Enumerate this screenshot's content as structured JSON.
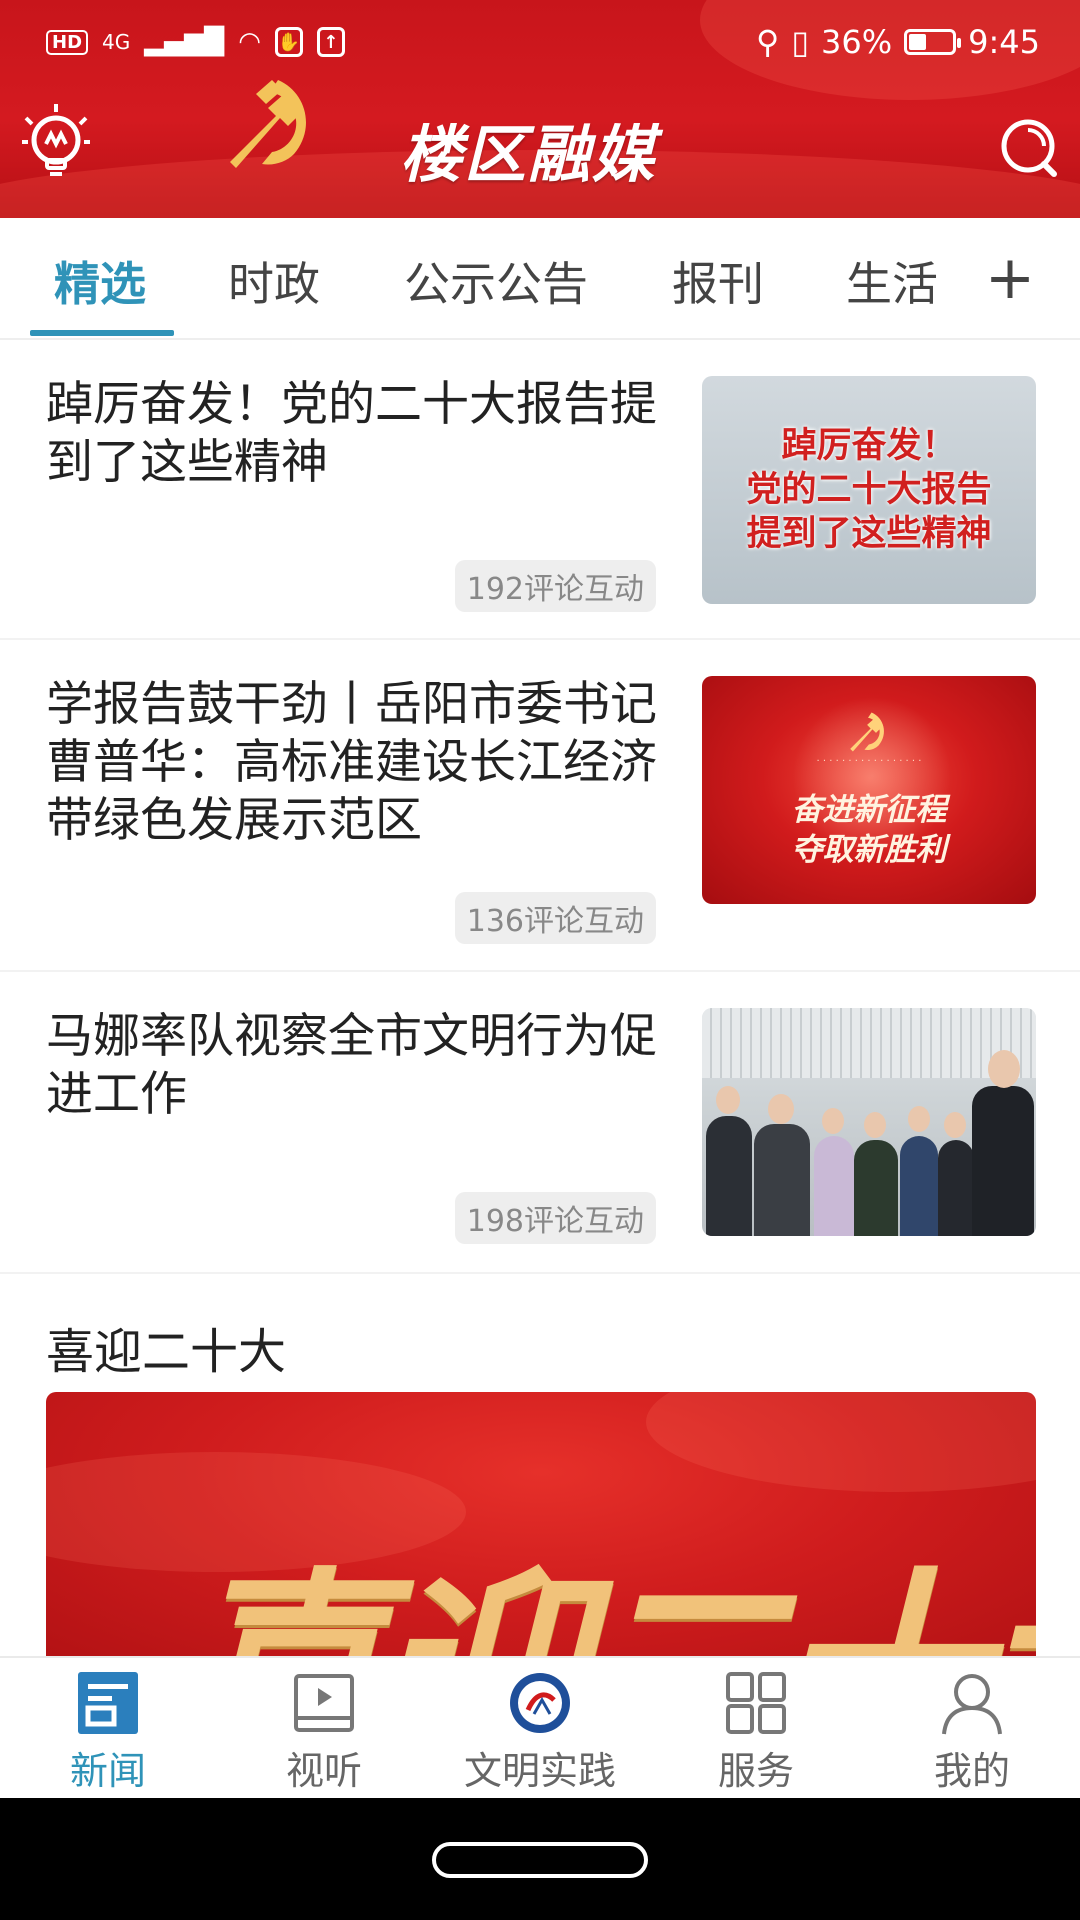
{
  "status_bar": {
    "left_indicators": [
      "HD",
      "4G"
    ],
    "battery": "36%",
    "time": "9:45"
  },
  "header": {
    "app_title": "楼区融媒",
    "bulb_icon": "bulb-icon",
    "search_icon": "search-icon",
    "background_color": "#c8151b"
  },
  "tabs": {
    "items": [
      {
        "label": "精选",
        "active": true
      },
      {
        "label": "时政",
        "active": false
      },
      {
        "label": "公示公告",
        "active": false
      },
      {
        "label": "报刊",
        "active": false
      },
      {
        "label": "生活",
        "active": false
      }
    ],
    "add_label": "+",
    "accent_color": "#2f93b8"
  },
  "articles": [
    {
      "title": "踔厉奋发！党的二十大报告提到了这些精神",
      "comments": "192评论互动",
      "thumb_lines": [
        "踔厉奋发！",
        "党的二十大报告",
        "提到了这些精神"
      ]
    },
    {
      "title": "学报告鼓干劲丨岳阳市委书记曹普华：高标准建设长江经济带绿色发展示范区",
      "comments": "136评论互动",
      "thumb_lines": [
        "奋进新征程",
        "夺取新胜利"
      ]
    },
    {
      "title": "马娜率队视察全市文明行为促进工作",
      "comments": "198评论互动"
    }
  ],
  "section": {
    "title": "喜迎二十大",
    "banner_text": "喜迎二十大"
  },
  "bottom_nav": {
    "items": [
      {
        "label": "新闻",
        "icon": "news-icon",
        "active": true
      },
      {
        "label": "视听",
        "icon": "video-icon",
        "active": false
      },
      {
        "label": "文明实践",
        "icon": "civilization-badge-icon",
        "active": false
      },
      {
        "label": "服务",
        "icon": "grid-icon",
        "active": false
      },
      {
        "label": "我的",
        "icon": "person-icon",
        "active": false
      }
    ]
  }
}
